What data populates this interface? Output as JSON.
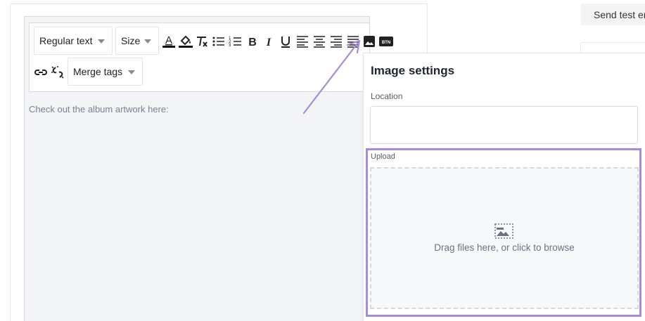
{
  "toolbar": {
    "text_style": "Regular text",
    "size": "Size",
    "merge_tags": "Merge tags",
    "image_icon_label": "BTN"
  },
  "editor": {
    "content": "Check out the album artwork here:"
  },
  "header": {
    "send_test_label": "Send test er"
  },
  "image_settings": {
    "title": "Image settings",
    "location_label": "Location",
    "location_value": "",
    "upload_label": "Upload",
    "drop_text": "Drag files here, or click to browse"
  },
  "colors": {
    "highlight": "#a78bdb",
    "arrow": "#a78bdb"
  }
}
